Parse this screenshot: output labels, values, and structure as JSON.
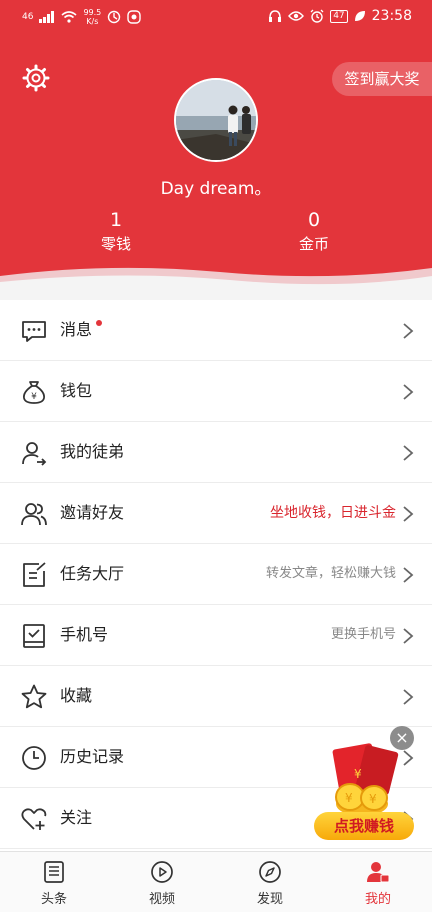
{
  "status_bar": {
    "signal": "46",
    "net_speed": "99.5",
    "net_unit": "K/s",
    "battery": "47",
    "time": "23:58"
  },
  "header": {
    "checkin_label": "签到赢大奖",
    "username": "Day dream。",
    "stats": [
      {
        "value": "1",
        "label": "零钱"
      },
      {
        "value": "0",
        "label": "金币"
      }
    ],
    "accent_color": "#e3353b"
  },
  "menu": [
    {
      "icon": "message-icon",
      "label": "消息",
      "has_dot": true,
      "hint": ""
    },
    {
      "icon": "money-bag-icon",
      "label": "钱包",
      "has_dot": false,
      "hint": ""
    },
    {
      "icon": "apprentice-icon",
      "label": "我的徒弟",
      "has_dot": false,
      "hint": ""
    },
    {
      "icon": "invite-icon",
      "label": "邀请好友",
      "has_dot": false,
      "hint": "坐地收钱，日进斗金"
    },
    {
      "icon": "task-icon",
      "label": "任务大厅",
      "has_dot": false,
      "hint": "转发文章，轻松赚大钱"
    },
    {
      "icon": "phone-icon",
      "label": "手机号",
      "has_dot": false,
      "hint": "更换手机号"
    },
    {
      "icon": "star-icon",
      "label": "收藏",
      "has_dot": false,
      "hint": ""
    },
    {
      "icon": "clock-icon",
      "label": "历史记录",
      "has_dot": false,
      "hint": ""
    },
    {
      "icon": "heart-plus-icon",
      "label": "关注",
      "has_dot": false,
      "hint": ""
    }
  ],
  "promo": {
    "label": "点我赚钱",
    "close": "×"
  },
  "tabs": [
    {
      "icon": "news-icon",
      "label": "头条",
      "active": false
    },
    {
      "icon": "video-icon",
      "label": "视频",
      "active": false
    },
    {
      "icon": "compass-icon",
      "label": "发现",
      "active": false
    },
    {
      "icon": "profile-icon",
      "label": "我的",
      "active": true
    }
  ]
}
